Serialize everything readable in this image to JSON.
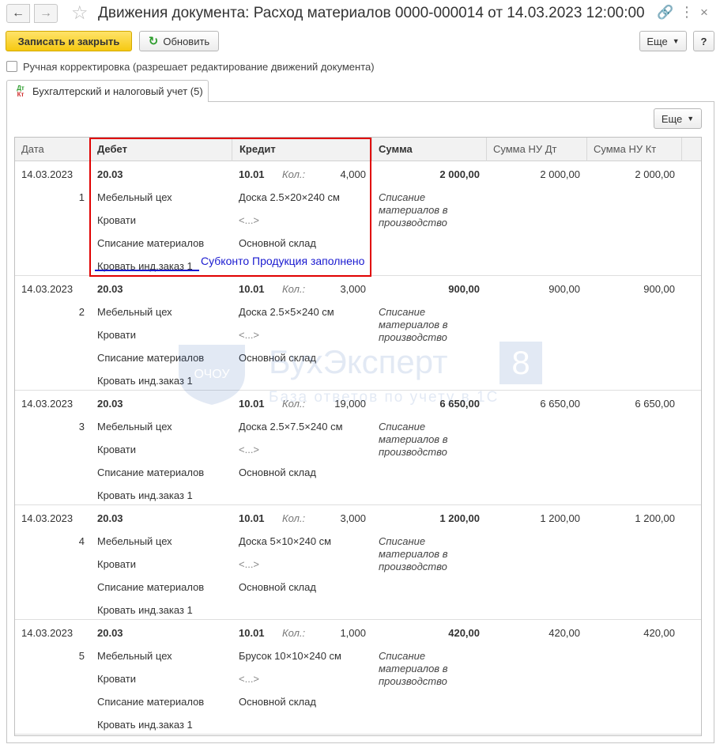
{
  "window": {
    "title": "Движения документа: Расход материалов 0000-000014 от 14.03.2023 12:00:00",
    "nav_back": "←",
    "nav_forward": "→",
    "star": "☆",
    "link": "🔗",
    "menu": "⋮",
    "close": "×"
  },
  "toolbar": {
    "save_close": "Записать и закрыть",
    "refresh": "Обновить",
    "more": "Еще",
    "help": "?"
  },
  "manual_correction": {
    "label": "Ручная корректировка (разрешает редактирование движений документа)",
    "checked": false
  },
  "tab": {
    "icon_top": "Дт",
    "icon_bottom": "Кт",
    "label": "Бухгалтерский и налоговый учет (5)"
  },
  "table_toolbar": {
    "more": "Еще"
  },
  "table": {
    "headers": {
      "date": "Дата",
      "debit": "Дебет",
      "credit": "Кредит",
      "amount": "Сумма",
      "amount_nu_dt": "Сумма НУ Дт",
      "amount_nu_kt": "Сумма НУ Кт"
    },
    "qty_label": "Кол.:",
    "rows": [
      {
        "date": "14.03.2023",
        "num": "1",
        "debit_account": "20.03",
        "debit_sub1": "Мебельный цех",
        "debit_sub2": "Кровати",
        "debit_sub3": "Списание материалов",
        "debit_sub4": "Кровать инд.заказ 1",
        "credit_account": "10.01",
        "qty": "4,000",
        "credit_sub1": "Доска 2.5×20×240 см",
        "credit_sub2": "<...>",
        "credit_sub3": "Основной склад",
        "amount": "2 000,00",
        "content": "Списание материалов в производство",
        "nu_dt": "2 000,00",
        "nu_kt": "2 000,00"
      },
      {
        "date": "14.03.2023",
        "num": "2",
        "debit_account": "20.03",
        "debit_sub1": "Мебельный цех",
        "debit_sub2": "Кровати",
        "debit_sub3": "Списание материалов",
        "debit_sub4": "Кровать инд.заказ 1",
        "credit_account": "10.01",
        "qty": "3,000",
        "credit_sub1": "Доска 2.5×5×240 см",
        "credit_sub2": "<...>",
        "credit_sub3": "Основной склад",
        "amount": "900,00",
        "content": "Списание материалов в производство",
        "nu_dt": "900,00",
        "nu_kt": "900,00"
      },
      {
        "date": "14.03.2023",
        "num": "3",
        "debit_account": "20.03",
        "debit_sub1": "Мебельный цех",
        "debit_sub2": "Кровати",
        "debit_sub3": "Списание материалов",
        "debit_sub4": "Кровать инд.заказ 1",
        "credit_account": "10.01",
        "qty": "19,000",
        "credit_sub1": "Доска 2.5×7.5×240 см",
        "credit_sub2": "<...>",
        "credit_sub3": "Основной склад",
        "amount": "6 650,00",
        "content": "Списание материалов в производство",
        "nu_dt": "6 650,00",
        "nu_kt": "6 650,00"
      },
      {
        "date": "14.03.2023",
        "num": "4",
        "debit_account": "20.03",
        "debit_sub1": "Мебельный цех",
        "debit_sub2": "Кровати",
        "debit_sub3": "Списание материалов",
        "debit_sub4": "Кровать инд.заказ 1",
        "credit_account": "10.01",
        "qty": "3,000",
        "credit_sub1": "Доска 5×10×240 см",
        "credit_sub2": "<...>",
        "credit_sub3": "Основной склад",
        "amount": "1 200,00",
        "content": "Списание материалов в производство",
        "nu_dt": "1 200,00",
        "nu_kt": "1 200,00"
      },
      {
        "date": "14.03.2023",
        "num": "5",
        "debit_account": "20.03",
        "debit_sub1": "Мебельный цех",
        "debit_sub2": "Кровати",
        "debit_sub3": "Списание материалов",
        "debit_sub4": "Кровать инд.заказ 1",
        "credit_account": "10.01",
        "qty": "1,000",
        "credit_sub1": "Брусок 10×10×240 см",
        "credit_sub2": "<...>",
        "credit_sub3": "Основной склад",
        "amount": "420,00",
        "content": "Списание материалов в производство",
        "nu_dt": "420,00",
        "nu_kt": "420,00"
      }
    ]
  },
  "annotation": {
    "text": "Субконто Продукция заполнено",
    "highlight_color": "#e00000",
    "text_color": "#1a1ad0"
  },
  "watermark": {
    "title": "БухЭксперт",
    "badge": "8",
    "subtitle": "База ответов по учету в 1С",
    "logo_text": "ОЧОУ"
  },
  "colors": {
    "primary_button": "#f6c911",
    "refresh_icon": "#2c9c2c"
  }
}
